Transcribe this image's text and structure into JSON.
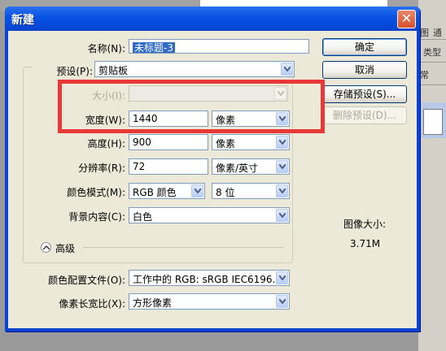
{
  "window": {
    "title": "新建"
  },
  "fields": {
    "name": {
      "label": "名称(N):",
      "value": "未标题-3"
    },
    "preset": {
      "label": "预设(P):",
      "value": "剪贴板"
    },
    "size": {
      "label": "大小(I):",
      "value": ""
    },
    "width": {
      "label": "宽度(W):",
      "value": "1440",
      "unit": "像素"
    },
    "height": {
      "label": "高度(H):",
      "value": "900",
      "unit": "像素"
    },
    "resolution": {
      "label": "分辨率(R):",
      "value": "72",
      "unit": "像素/英寸"
    },
    "color_mode": {
      "label": "颜色模式(M):",
      "value": "RGB 颜色",
      "depth": "8 位"
    },
    "background": {
      "label": "背景内容(C):",
      "value": "白色"
    }
  },
  "advanced": {
    "label": "高级",
    "profile": {
      "label": "颜色配置文件(O):",
      "value": "工作中的 RGB: sRGB IEC6196..."
    },
    "aspect": {
      "label": "像素长宽比(X):",
      "value": "方形像素"
    }
  },
  "buttons": {
    "ok": "确定",
    "cancel": "取消",
    "save_preset": "存储预设(S)...",
    "delete_preset": "删除预设(D)..."
  },
  "image_size": {
    "label": "图像大小:",
    "value": "3.71M"
  },
  "background_app": {
    "tab1": "图",
    "tab2": "通",
    "tab3": "类型",
    "tab4": "常"
  },
  "colors": {
    "highlight": "#e93838",
    "title_blue": "#0a54e3",
    "dialog_bg": "#ece9d8"
  }
}
